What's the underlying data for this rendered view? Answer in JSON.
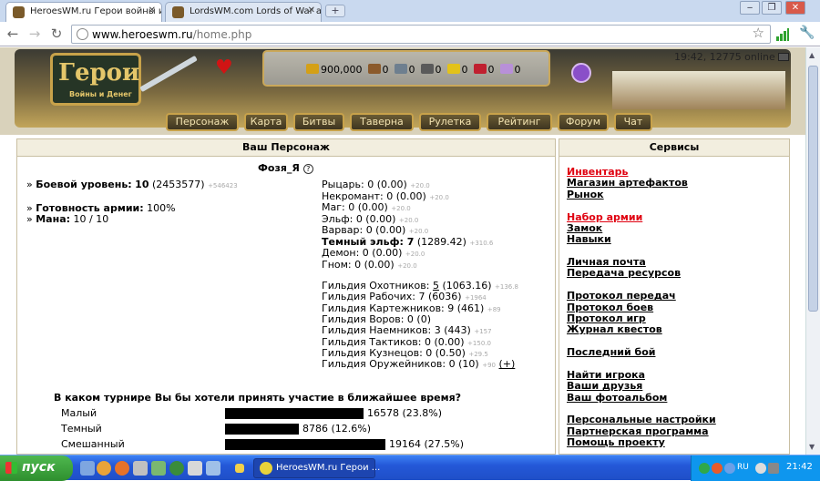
{
  "browser": {
    "tabs": [
      {
        "title": "HeroesWM.ru Герои войны и",
        "active": true
      },
      {
        "title": "LordsWM.com Lords of War an",
        "active": false
      }
    ],
    "new_tab": "+",
    "url_host": "www.heroeswm.ru",
    "url_path": "/home.php",
    "window_buttons": [
      "‒",
      "❐",
      "✕"
    ]
  },
  "header": {
    "logo_title": "Герои",
    "logo_subtitle": "Войны и Денег",
    "time_online": "19:42, 12775 online",
    "resources": [
      "900,000",
      "0",
      "0",
      "0",
      "0",
      "0",
      "0"
    ],
    "resource_colors": [
      "#d4a017",
      "#8b5a2b",
      "#6e7f8f",
      "#5a5a5a",
      "#e3c21a",
      "#c02030",
      "#b890d8"
    ],
    "menu": [
      "Персонаж",
      "Карта",
      "Битвы",
      "Таверна",
      "Рулетка",
      "Рейтинг",
      "Форум",
      "Чат"
    ]
  },
  "character": {
    "header": "Ваш Персонаж",
    "name": "Фозя_Я",
    "combat_label": "Боевой уровень:",
    "combat_level": "10",
    "combat_exp": "(2453577)",
    "combat_to_next": "+546423",
    "army_label": "Готовность армии:",
    "army_value": "100%",
    "mana_label": "Мана:",
    "mana_value": "10 / 10",
    "factions": [
      {
        "name": "Рыцарь:",
        "value": "0 (0.00)",
        "next": "+20.0",
        "bold": false
      },
      {
        "name": "Некромант:",
        "value": "0 (0.00)",
        "next": "+20.0",
        "bold": false
      },
      {
        "name": "Маг:",
        "value": "0 (0.00)",
        "next": "+20.0",
        "bold": false
      },
      {
        "name": "Эльф:",
        "value": "0 (0.00)",
        "next": "+20.0",
        "bold": false
      },
      {
        "name": "Варвар:",
        "value": "0 (0.00)",
        "next": "+20.0",
        "bold": false
      },
      {
        "name": "Темный эльф: 7",
        "value": "(1289.42)",
        "next": "+310.6",
        "bold": true
      },
      {
        "name": "Демон:",
        "value": "0 (0.00)",
        "next": "+20.0",
        "bold": false
      },
      {
        "name": "Гном:",
        "value": "0 (0.00)",
        "next": "+20.0",
        "bold": false
      }
    ],
    "guilds": [
      {
        "name": "Гильдия Охотников:",
        "level": "5",
        "value": "(1063.16)",
        "next": "+136.8"
      },
      {
        "name": "Гильдия Рабочих:",
        "level": "7",
        "value": "(6036)",
        "next": "+1964"
      },
      {
        "name": "Гильдия Картежников:",
        "level": "9",
        "value": "(461)",
        "next": "+89"
      },
      {
        "name": "Гильдия Воров:",
        "level": "0",
        "value": "(0)",
        "next": ""
      },
      {
        "name": "Гильдия Наемников:",
        "level": "3",
        "value": "(443)",
        "next": "+157"
      },
      {
        "name": "Гильдия Тактиков:",
        "level": "0",
        "value": "(0.00)",
        "next": "+150.0"
      },
      {
        "name": "Гильдия Кузнецов:",
        "level": "0",
        "value": "(0.50)",
        "next": "+29.5"
      },
      {
        "name": "Гильдия Оружейников:",
        "level": "0",
        "value": "(10)",
        "next": "+90",
        "extra": "(+)"
      }
    ]
  },
  "poll": {
    "question": "В каком турнире Вы бы хотели принять участие в ближайшее время?",
    "options": [
      {
        "label": "Малый",
        "votes": "16578",
        "percent": "(23.8%)",
        "share": 23.8
      },
      {
        "label": "Темный",
        "votes": "8786",
        "percent": "(12.6%)",
        "share": 12.6
      },
      {
        "label": "Смешанный",
        "votes": "19164",
        "percent": "(27.5%)",
        "share": 27.5
      }
    ]
  },
  "services": {
    "header": "Сервисы",
    "groups": [
      [
        {
          "label": "Инвентарь",
          "red": true
        },
        {
          "label": "Магазин артефактов"
        },
        {
          "label": "Рынок"
        }
      ],
      [
        {
          "label": "Набор армии",
          "red": true
        },
        {
          "label": "Замок"
        },
        {
          "label": "Навыки"
        }
      ],
      [
        {
          "label": "Личная почта"
        },
        {
          "label": "Передача ресурсов"
        }
      ],
      [
        {
          "label": "Протокол передач"
        },
        {
          "label": "Протокол боев"
        },
        {
          "label": "Протокол игр"
        },
        {
          "label": "Журнал квестов"
        }
      ],
      [
        {
          "label": "Последний бой"
        }
      ],
      [
        {
          "label": "Найти игрока"
        },
        {
          "label": "Ваши друзья"
        },
        {
          "label": "Ваш фотоальбом"
        }
      ],
      [
        {
          "label": "Персональные настройки"
        },
        {
          "label": "Партнерская программа"
        },
        {
          "label": "Помощь проекту"
        }
      ]
    ]
  },
  "taskbar": {
    "start": "пуск",
    "task": "HeroesWM.ru Герои ...",
    "clock": "21:42",
    "lang": "RU"
  }
}
